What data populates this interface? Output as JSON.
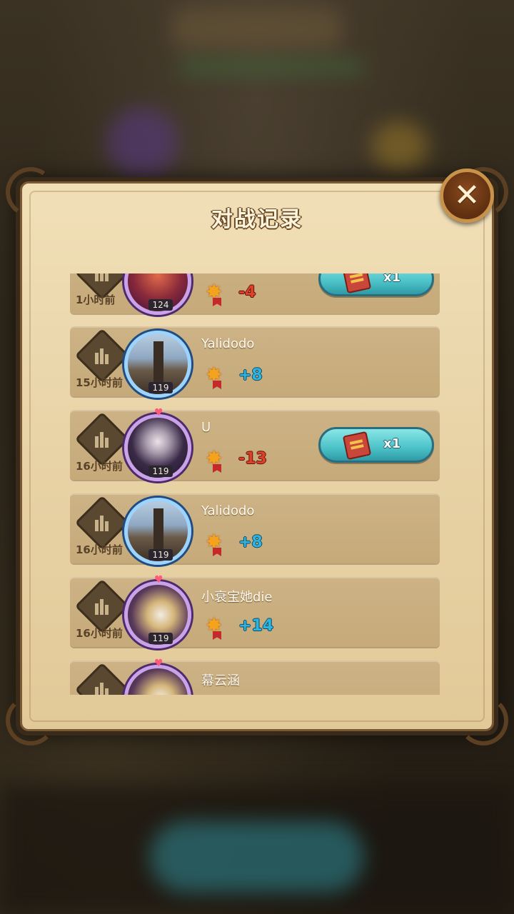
{
  "dialog": {
    "title": "对战记录",
    "close_icon": "✕"
  },
  "rows": [
    {
      "time": "1小时前",
      "name": "",
      "level": "124",
      "delta": "-4",
      "reward": "x1",
      "avatar": "red"
    },
    {
      "time": "15小时前",
      "name": "Yalidodo",
      "level": "119",
      "delta": "+8",
      "reward": "",
      "avatar": "tower"
    },
    {
      "time": "16小时前",
      "name": "U",
      "level": "119",
      "delta": "-13",
      "reward": "x1",
      "avatar": "dark"
    },
    {
      "time": "16小时前",
      "name": "Yalidodo",
      "level": "119",
      "delta": "+8",
      "reward": "",
      "avatar": "tower"
    },
    {
      "time": "16小时前",
      "name": "小衰宝她die",
      "level": "119",
      "delta": "+14",
      "reward": "",
      "avatar": "wing"
    },
    {
      "time": "",
      "name": "幕云涵",
      "level": "",
      "delta": "",
      "reward": "",
      "avatar": "wing"
    }
  ],
  "colors": {
    "positive": "#2fb4e0",
    "negative": "#e0402a",
    "reward_bg": "#4bc2c8"
  }
}
